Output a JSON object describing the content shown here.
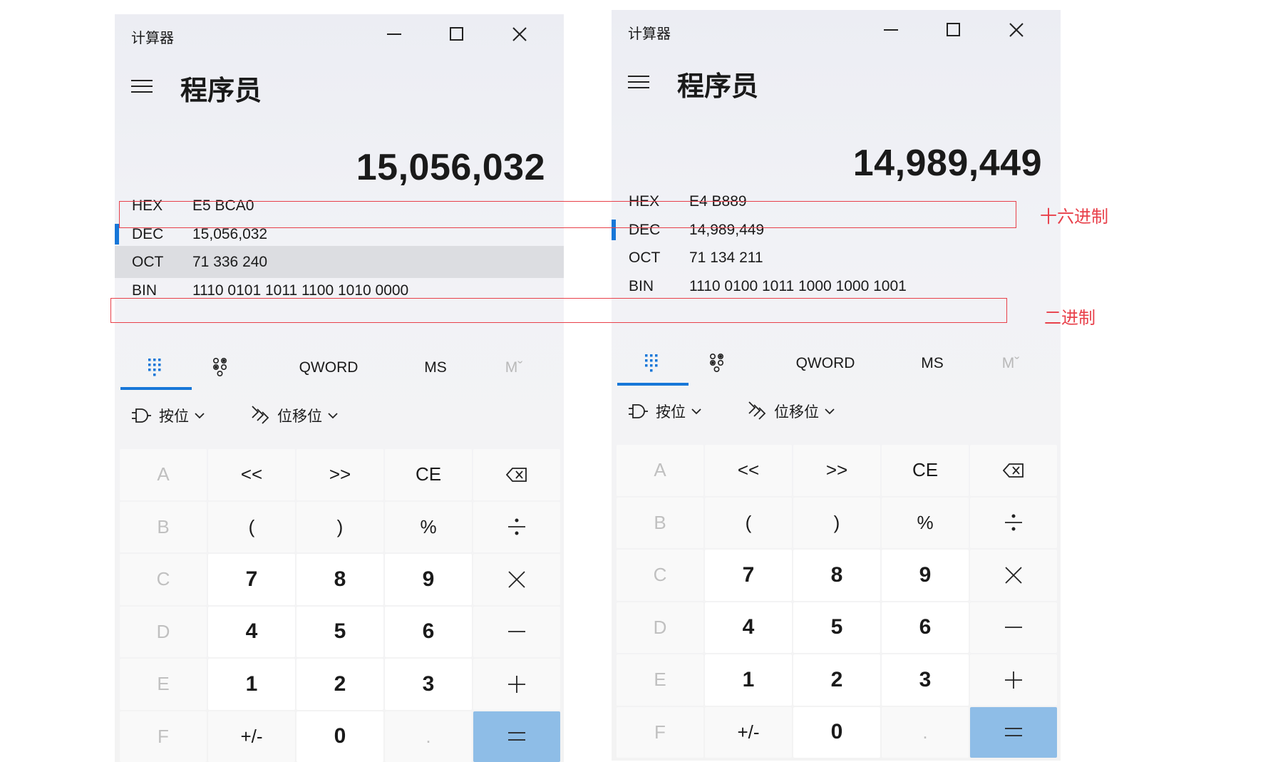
{
  "calculators": [
    {
      "window_title": "计算器",
      "mode_title": "程序员",
      "display_value": "15,056,032",
      "radix": [
        {
          "label": "HEX",
          "value": "E5 BCA0"
        },
        {
          "label": "DEC",
          "value": "15,056,032"
        },
        {
          "label": "OCT",
          "value": "71 336 240"
        },
        {
          "label": "BIN",
          "value": "1110 0101 1011 1100 1010 0000"
        }
      ],
      "selected_radix": "DEC",
      "hovered_radix": "OCT",
      "toolbar": {
        "word_size": "QWORD",
        "memory_store": "MS",
        "memory_view": "Mˇ"
      },
      "operators": {
        "bitwise": "按位",
        "bit_shift": "位移位"
      }
    },
    {
      "window_title": "计算器",
      "mode_title": "程序员",
      "display_value": "14,989,449",
      "radix": [
        {
          "label": "HEX",
          "value": "E4 B889"
        },
        {
          "label": "DEC",
          "value": "14,989,449"
        },
        {
          "label": "OCT",
          "value": "71 134 211"
        },
        {
          "label": "BIN",
          "value": "1110 0100 1011 1000 1000 1001"
        }
      ],
      "selected_radix": "DEC",
      "hovered_radix": "",
      "toolbar": {
        "word_size": "QWORD",
        "memory_store": "MS",
        "memory_view": "Mˇ"
      },
      "operators": {
        "bitwise": "按位",
        "bit_shift": "位移位"
      }
    }
  ],
  "keypad": [
    [
      "A",
      "<<",
      ">>",
      "CE",
      "backspace-icon"
    ],
    [
      "B",
      "(",
      ")",
      "%",
      "divide-icon"
    ],
    [
      "C",
      "7",
      "8",
      "9",
      "multiply-icon"
    ],
    [
      "D",
      "4",
      "5",
      "6",
      "minus-icon"
    ],
    [
      "E",
      "1",
      "2",
      "3",
      "plus-icon"
    ],
    [
      "F",
      "+/-",
      "0",
      ".",
      "equals-icon"
    ]
  ],
  "annotations": {
    "hex": "十六进制",
    "bin": "二进制"
  },
  "colors": {
    "accent": "#1777d8",
    "equals_key": "#8ebde7",
    "annotation": "#e8404a",
    "hover_row": "#dcdde1"
  }
}
